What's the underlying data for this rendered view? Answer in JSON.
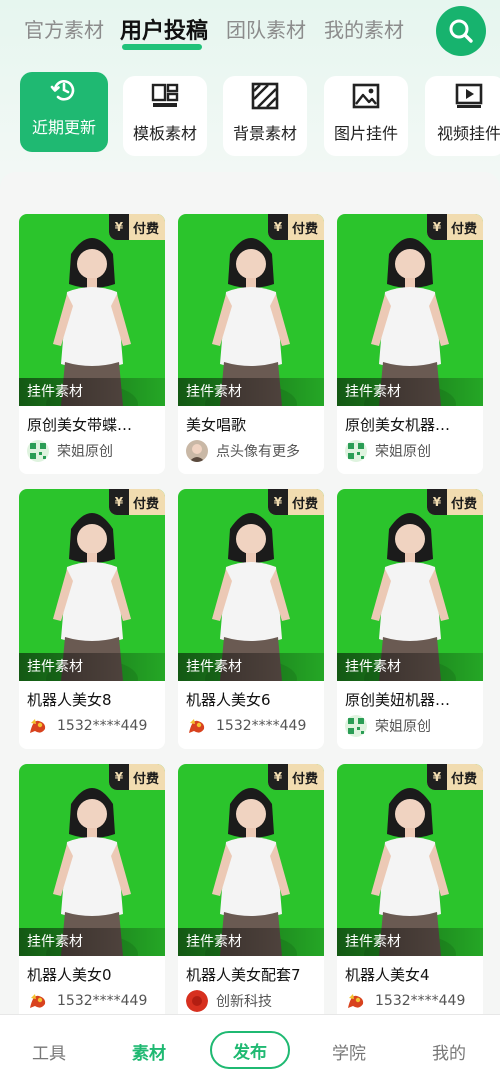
{
  "top_tabs": [
    {
      "label": "官方素材"
    },
    {
      "label": "用户投稿",
      "active": true
    },
    {
      "label": "团队素材"
    },
    {
      "label": "我的素材"
    }
  ],
  "search_icon": "search-icon",
  "categories": [
    {
      "label": "近期更新",
      "icon": "clock-refresh-icon",
      "active": true
    },
    {
      "label": "模板素材",
      "icon": "template-icon"
    },
    {
      "label": "背景素材",
      "icon": "background-icon"
    },
    {
      "label": "图片挂件",
      "icon": "image-icon"
    },
    {
      "label": "视频挂件",
      "icon": "video-icon"
    }
  ],
  "cards": [
    {
      "title": "原创美女带蝶…",
      "tag": "挂件素材",
      "badge": "付费",
      "badge_symbol": "¥",
      "author": "荣姐原创",
      "avatar": "qr-avatar"
    },
    {
      "title": "美女唱歌",
      "tag": "挂件素材",
      "badge": "付费",
      "badge_symbol": "¥",
      "author": "点头像有更多",
      "avatar": "photo-avatar"
    },
    {
      "title": "原创美女机器…",
      "tag": "挂件素材",
      "badge": "付费",
      "badge_symbol": "¥",
      "author": "荣姐原创",
      "avatar": "qr-avatar"
    },
    {
      "title": "机器人美女8",
      "tag": "挂件素材",
      "badge": "付费",
      "badge_symbol": "¥",
      "author": "1532****449",
      "avatar": "dragon-avatar"
    },
    {
      "title": "机器人美女6",
      "tag": "挂件素材",
      "badge": "付费",
      "badge_symbol": "¥",
      "author": "1532****449",
      "avatar": "dragon-avatar"
    },
    {
      "title": "原创美妞机器…",
      "tag": "挂件素材",
      "badge": "付费",
      "badge_symbol": "¥",
      "author": "荣姐原创",
      "avatar": "qr-avatar"
    },
    {
      "title": "机器人美女0",
      "tag": "挂件素材",
      "badge": "付费",
      "badge_symbol": "¥",
      "author": "1532****449",
      "avatar": "dragon-avatar"
    },
    {
      "title": "机器人美女配套7",
      "tag": "挂件素材",
      "badge": "付费",
      "badge_symbol": "¥",
      "author": "创新科技",
      "avatar": "red-logo-avatar"
    },
    {
      "title": "机器人美女4",
      "tag": "挂件素材",
      "badge": "付费",
      "badge_symbol": "¥",
      "author": "1532****449",
      "avatar": "dragon-avatar"
    }
  ],
  "bottom_nav": {
    "tools": "工具",
    "materials": "素材",
    "publish": "发布",
    "academy": "学院",
    "mine": "我的"
  },
  "colors": {
    "accent": "#1fb972",
    "green_screen": "#2bc42c",
    "badge_gold": "#f1dcb0"
  }
}
